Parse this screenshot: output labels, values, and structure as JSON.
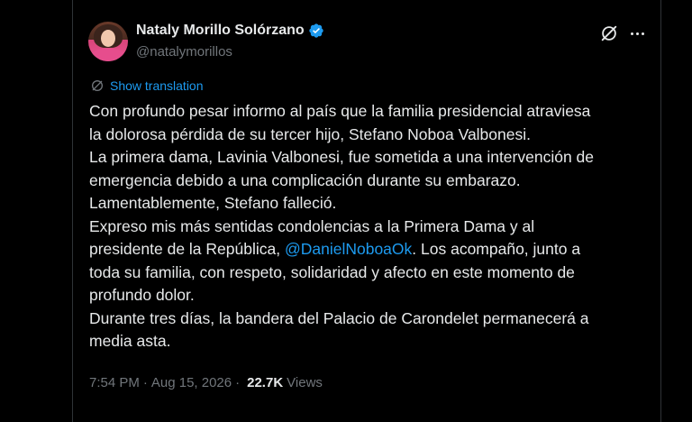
{
  "author": {
    "display_name": "Nataly Morillo Solórzano",
    "handle": "@natalymorillos",
    "verified": true
  },
  "translate": {
    "label": "Show translation"
  },
  "tweet": {
    "lines": [
      "Con profundo pesar informo al país que la familia presidencial atraviesa",
      "la dolorosa pérdida de su tercer hijo, Stefano Noboa Valbonesi.",
      "La primera dama, Lavinia Valbonesi, fue sometida a una intervención de",
      "emergencia debido a una complicación durante su embarazo.",
      "Lamentablemente, Stefano falleció.",
      "Expreso mis más sentidas condolencias a la Primera Dama y al",
      "presidente de la República,",
      "@DanielNoboaOk",
      ". Los acompaño, junto a",
      "toda su familia, con respeto, solidaridad y afecto en este momento de",
      "profundo dolor.",
      "Durante tres días, la bandera del Palacio de Carondelet permanecerá a",
      "media asta."
    ]
  },
  "meta": {
    "time": "7:54 PM",
    "separator": "·",
    "date": "Aug 15, 2026",
    "separator2": "·",
    "views_count": "22.7K",
    "views_label": "Views"
  },
  "icons": {
    "verified": "verified-badge-icon",
    "grok": "grok-icon",
    "more": "more-icon",
    "translate": "translate-icon"
  },
  "colors": {
    "background": "#000000",
    "text": "#e7e9ea",
    "secondary": "#71767b",
    "accent": "#1d9bf0"
  }
}
